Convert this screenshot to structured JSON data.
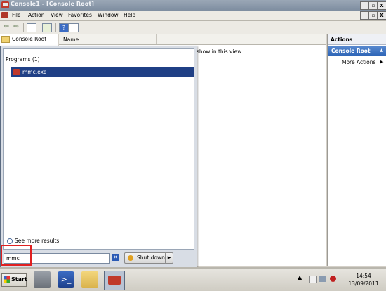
{
  "window": {
    "title": "Console1 - [Console Root]",
    "buttons": {
      "minimize": "_",
      "restore": "▫",
      "close": "X"
    }
  },
  "menubar": {
    "items": [
      "File",
      "Action",
      "View",
      "Favorites",
      "Window",
      "Help"
    ],
    "child_buttons": {
      "minimize": "_",
      "restore": "▫",
      "close": "X"
    }
  },
  "toolbar": {
    "icons": [
      "back-icon",
      "forward-icon",
      "show-hide-tree-icon",
      "export-list-icon",
      "help-icon",
      "show-hide-action-pane-icon"
    ]
  },
  "tree": {
    "root_label": "Console Root"
  },
  "list": {
    "column_name": "Name",
    "empty_message": "show in this view."
  },
  "actions": {
    "title": "Actions",
    "group": "Console Root",
    "more_actions": "More Actions"
  },
  "start_menu": {
    "section_label": "Programs (1)",
    "result_label": "mmc.exe",
    "see_more": "See more results",
    "search_value": "mmc",
    "shutdown_label": "Shut down"
  },
  "taskbar": {
    "start_label": "Start",
    "apps": [
      "server-manager-icon",
      "powershell-icon",
      "windows-explorer-icon",
      "mmc-icon"
    ],
    "clock_time": "14:54",
    "clock_date": "13/09/2011"
  },
  "colors": {
    "selection": "#1f3f85",
    "actions_group": "#2f66b8",
    "highlight_box": "#e02020"
  }
}
